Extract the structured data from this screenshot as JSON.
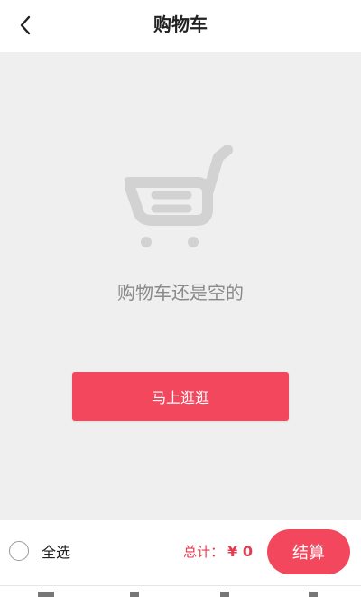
{
  "header": {
    "title": "购物车",
    "back_icon": "chevron-left-icon"
  },
  "empty": {
    "icon": "shopping-cart-icon",
    "message": "购物车还是空的",
    "button_label": "马上逛逛"
  },
  "footer": {
    "select_all_label": "全选",
    "total_label": "总计：",
    "total_value": "¥ 0",
    "checkout_label": "结算"
  },
  "colors": {
    "accent": "#f2475d",
    "price": "#e53b50",
    "background": "#efefef",
    "muted_text": "#8a8a8a"
  }
}
